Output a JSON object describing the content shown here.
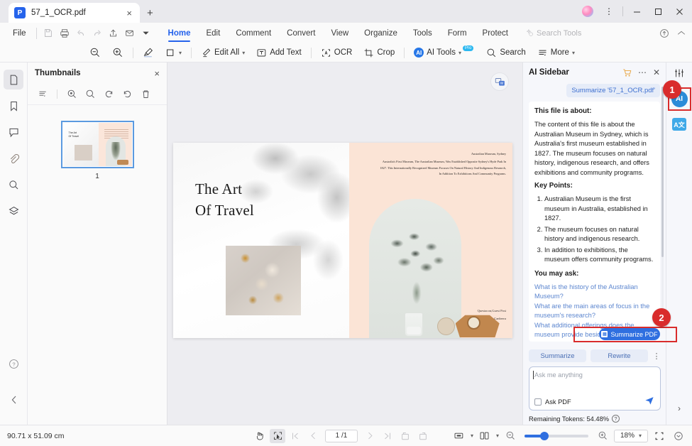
{
  "window": {
    "tab_title": "57_1_OCR.pdf",
    "app_logo": "P",
    "close_tab_icon": "×",
    "new_tab_icon": "+",
    "minimize_icon": "—",
    "maximize_icon": "▢",
    "close_icon": "✕",
    "more_icon": "⋮"
  },
  "menubar": {
    "file": "File",
    "items": [
      {
        "label": "Home",
        "active": true
      },
      {
        "label": "Edit",
        "active": false
      },
      {
        "label": "Comment",
        "active": false
      },
      {
        "label": "Convert",
        "active": false
      },
      {
        "label": "View",
        "active": false
      },
      {
        "label": "Organize",
        "active": false
      },
      {
        "label": "Tools",
        "active": false
      },
      {
        "label": "Form",
        "active": false
      },
      {
        "label": "Protect",
        "active": false
      }
    ],
    "search_tools": "Search Tools"
  },
  "toolbar": {
    "zoom_out": "zoom-out-icon",
    "zoom_in": "zoom-in-icon",
    "highlight": "highlighter-icon",
    "shape": "rectangle-icon",
    "edit_all": "Edit All",
    "add_text": "Add Text",
    "ocr": "OCR",
    "crop": "Crop",
    "ai_tools": "AI Tools",
    "ai_badge": "Pro",
    "search": "Search",
    "more": "More"
  },
  "left_rail": {
    "items": [
      "page-icon",
      "bookmark-icon",
      "comment-icon",
      "attachment-icon",
      "search-icon",
      "layers-icon"
    ],
    "help": "?",
    "collapse": "‹"
  },
  "thumbnails": {
    "title": "Thumbnails",
    "close": "×",
    "tools": [
      "list-icon",
      "zoom-in-icon",
      "zoom-out-icon",
      "rotate-left-icon",
      "rotate-right-icon",
      "delete-icon"
    ],
    "page_number": "1"
  },
  "document": {
    "title_line1": "The Art",
    "title_line2": "Of Travel",
    "paragraph_heading": "Australian Museum, Sydney",
    "paragraph_body": "Australia's First Museum, The Australian Museum, Was Established Opposite Sydney's Hyde Park In 1827. This Internationally Recognized Museum Focuses On Natural History And Indigenous Research, In Addition To Exhibitions And Community Programs.",
    "caption_line1": "Questacon,Guest Post",
    "caption_line2": "Canberra"
  },
  "ai_sidebar": {
    "title": "AI Sidebar",
    "cart_icon": "🛒",
    "more_icon": "⋯",
    "close_icon": "✕",
    "prompt_chip": "Summarize '57_1_OCR.pdf'",
    "about_heading": "This file is about:",
    "about_body": "The content of this file is about the Australian Museum in Sydney, which is Australia's first museum established in 1827. The museum focuses on natural history, indigenous research, and offers exhibitions and community programs.",
    "key_points_heading": "Key Points:",
    "key_points": [
      "Australian Museum is the first museum in Australia, established in 1827.",
      "The museum focuses on natural history and indigenous research.",
      "In addition to exhibitions, the museum offers community programs."
    ],
    "you_may_ask_heading": "You may ask:",
    "suggested_questions": [
      "What is the history of the Australian Museum?",
      "What are the main areas of focus in the museum's research?",
      "What additional offerings does the museum provide besides exhibitions?"
    ],
    "summarize_pdf_button": "Summarize PDF",
    "quick_actions": [
      "Summarize",
      "Rewrite"
    ],
    "quick_more": "⋮",
    "ask_placeholder": "Ask me anything",
    "ask_pdf_label": "Ask PDF",
    "send_icon": "➤",
    "tokens_label": "Remaining Tokens: 54.48%",
    "tokens_help": "?"
  },
  "right_rail": {
    "settings_icon": "sliders-icon",
    "ai_icon": "AI",
    "translate_icon": "A文",
    "collapse_icon": "›"
  },
  "badges": [
    {
      "number": "1"
    },
    {
      "number": "2"
    }
  ],
  "status": {
    "dimensions": "90.71 x 51.09 cm",
    "hand_tool": "hand-icon",
    "select_tool": "select-icon",
    "page_current": "1 /1",
    "view_mode": "single-page-icon",
    "layout_mode": "two-page-icon",
    "zoom_level": "18%",
    "fit_icon": "fit-screen-icon",
    "more_zoom_icon": "⌄"
  },
  "colors": {
    "accent": "#2f6fe0",
    "highlight_red": "#d92c2c",
    "page_right_bg": "#fbe4d6",
    "chip_bg": "#e6ecf8"
  }
}
